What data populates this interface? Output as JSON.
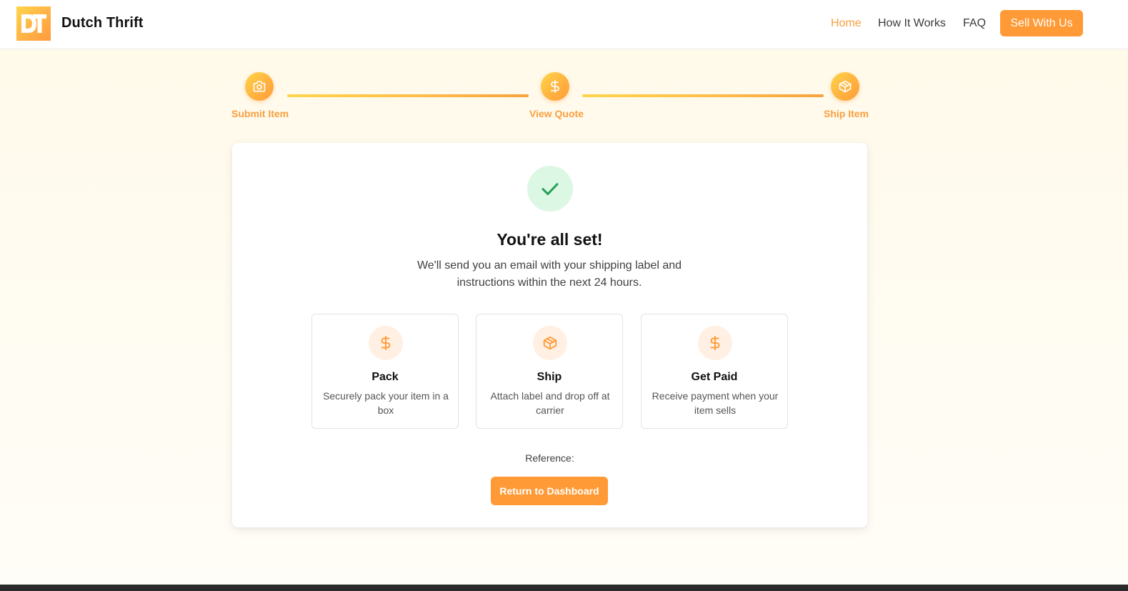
{
  "header": {
    "brand": "Dutch Thrift",
    "logo_text": "DT",
    "nav": [
      {
        "label": "Home",
        "active": true
      },
      {
        "label": "How It Works",
        "active": false
      },
      {
        "label": "FAQ",
        "active": false
      }
    ],
    "cta_label": "Sell With Us"
  },
  "stepper": {
    "steps": [
      {
        "label": "Submit Item",
        "icon": "camera-icon"
      },
      {
        "label": "View Quote",
        "icon": "dollar-icon"
      },
      {
        "label": "Ship Item",
        "icon": "package-icon"
      }
    ]
  },
  "confirmation": {
    "icon": "check-icon",
    "title": "You're all set!",
    "subtitle": "We'll send you an email with your shipping label and instructions within the next 24 hours.",
    "cards": [
      {
        "icon": "dollar-icon",
        "title": "Pack",
        "description": "Securely pack your item in a box"
      },
      {
        "icon": "package-icon",
        "title": "Ship",
        "description": "Attach label and drop off at carrier"
      },
      {
        "icon": "dollar-icon",
        "title": "Get Paid",
        "description": "Receive payment when your item sells"
      }
    ],
    "reference_label": "Reference:",
    "return_button": "Return to Dashboard"
  },
  "colors": {
    "accent": "#ff9a36",
    "accent_text": "#f7a040",
    "success_bg": "#dcf7e4",
    "success": "#22a055"
  }
}
